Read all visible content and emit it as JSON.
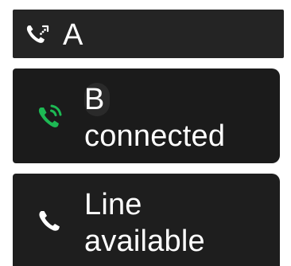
{
  "lines": [
    {
      "id": "A",
      "label": "A",
      "status": "",
      "icon": "call-outgoing-icon",
      "icon_color": "#ffffff"
    },
    {
      "id": "B",
      "label": "B",
      "status": "connected",
      "icon": "call-connected-icon",
      "icon_color": "#1db954"
    },
    {
      "id": "C",
      "label": "Line",
      "status": "available",
      "icon": "phone-icon",
      "icon_color": "#ffffff"
    }
  ]
}
